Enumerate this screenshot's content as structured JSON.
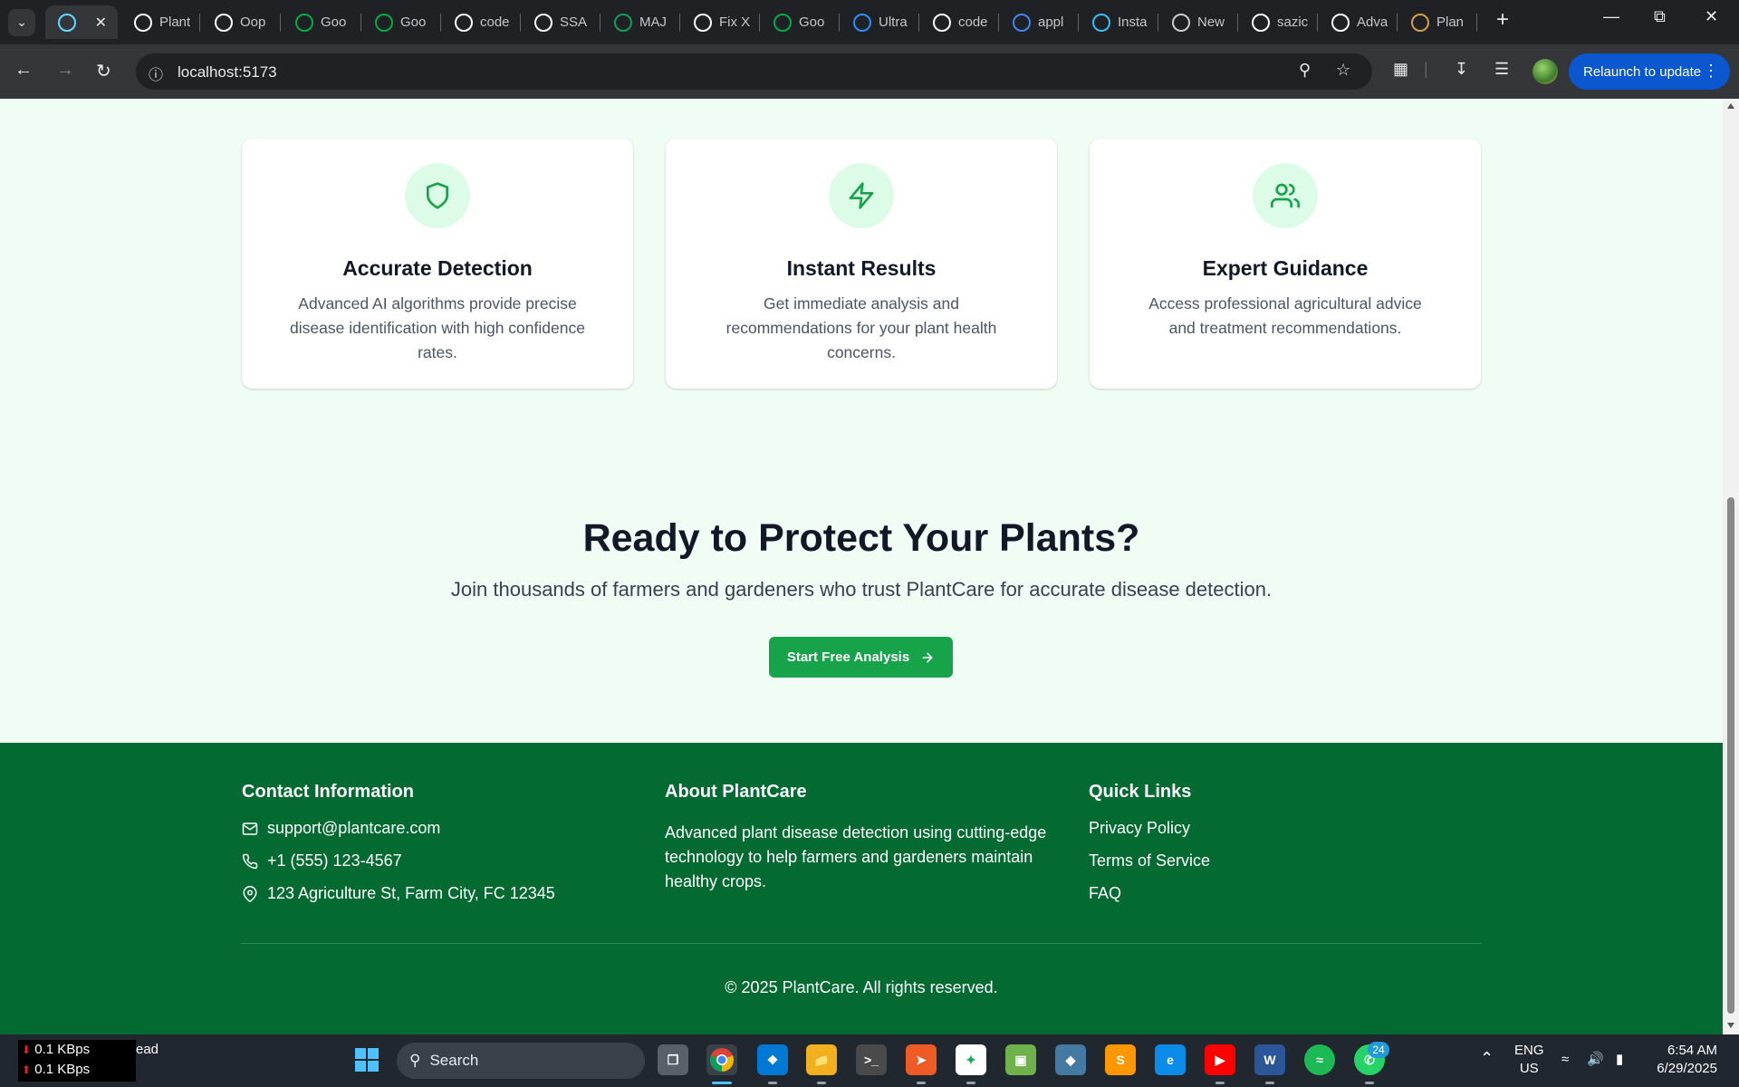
{
  "browser": {
    "tabs": [
      {
        "label": "",
        "icon": "react-icon",
        "color": "#61dafb",
        "active": true
      },
      {
        "label": "Plant",
        "icon": "chatgpt-icon",
        "color": "#ffffff"
      },
      {
        "label": "Oop",
        "icon": "chatgpt-icon",
        "color": "#ffffff"
      },
      {
        "label": "Goo",
        "icon": "google-meet-icon",
        "color": "#00ac47"
      },
      {
        "label": "Goo",
        "icon": "google-meet-icon",
        "color": "#00ac47"
      },
      {
        "label": "code",
        "icon": "github-icon",
        "color": "#ffffff"
      },
      {
        "label": "SSA",
        "icon": "github-icon",
        "color": "#ffffff"
      },
      {
        "label": "MAJ",
        "icon": "google-sheets-icon",
        "color": "#0f9d58"
      },
      {
        "label": "Fix X",
        "icon": "chatgpt-icon",
        "color": "#ffffff"
      },
      {
        "label": "Goo",
        "icon": "google-meet-icon",
        "color": "#00ac47"
      },
      {
        "label": "Ultra",
        "icon": "chat-icon",
        "color": "#2d8cff"
      },
      {
        "label": "code",
        "icon": "github-icon",
        "color": "#ffffff"
      },
      {
        "label": "appl",
        "icon": "google-icon",
        "color": "#4285f4"
      },
      {
        "label": "Insta",
        "icon": "tailwind-icon",
        "color": "#38bdf8"
      },
      {
        "label": "New",
        "icon": "chrome-icon",
        "color": "#cccccc"
      },
      {
        "label": "sazic",
        "icon": "github-icon",
        "color": "#ffffff"
      },
      {
        "label": "Adva",
        "icon": "github-icon",
        "color": "#ffffff"
      },
      {
        "label": "Plan",
        "icon": "plant-icon",
        "color": "#d4a04c"
      }
    ],
    "url": "localhost:5173",
    "relaunch_label": "Relaunch to update"
  },
  "features": [
    {
      "title": "Accurate Detection",
      "description": "Advanced AI algorithms provide precise disease identification with high confidence rates.",
      "icon": "shield-icon"
    },
    {
      "title": "Instant Results",
      "description": "Get immediate analysis and recommendations for your plant health concerns.",
      "icon": "lightning-icon"
    },
    {
      "title": "Expert Guidance",
      "description": "Access professional agricultural advice and treatment recommendations.",
      "icon": "users-icon"
    }
  ],
  "cta": {
    "title": "Ready to Protect Your Plants?",
    "subtitle": "Join thousands of farmers and gardeners who trust PlantCare for accurate disease detection.",
    "button_label": "Start Free Analysis"
  },
  "footer": {
    "contact_title": "Contact Information",
    "email": "support@plantcare.com",
    "phone": "+1 (555) 123-4567",
    "address": "123 Agriculture St, Farm City, FC 12345",
    "about_title": "About PlantCare",
    "about_text": "Advanced plant disease detection using cutting-edge technology to help farmers and gardeners maintain healthy crops.",
    "links_title": "Quick Links",
    "links": [
      "Privacy Policy",
      "Terms of Service",
      "FAQ"
    ],
    "copyright": "© 2025 PlantCare. All rights reserved."
  },
  "taskbar": {
    "net_down": "0.1 KBps",
    "net_up": "0.1 KBps",
    "net_tail": "ead",
    "search_label": "Search",
    "whatsapp_badge": "24",
    "lang_top": "ENG",
    "lang_bottom": "US",
    "time": "6:54 AM",
    "date": "6/29/2025"
  },
  "colors": {
    "brand_green": "#16a34a",
    "footer_green": "#036b32",
    "page_bg": "#f0fdf4",
    "icon_circle": "#dcfce7"
  }
}
